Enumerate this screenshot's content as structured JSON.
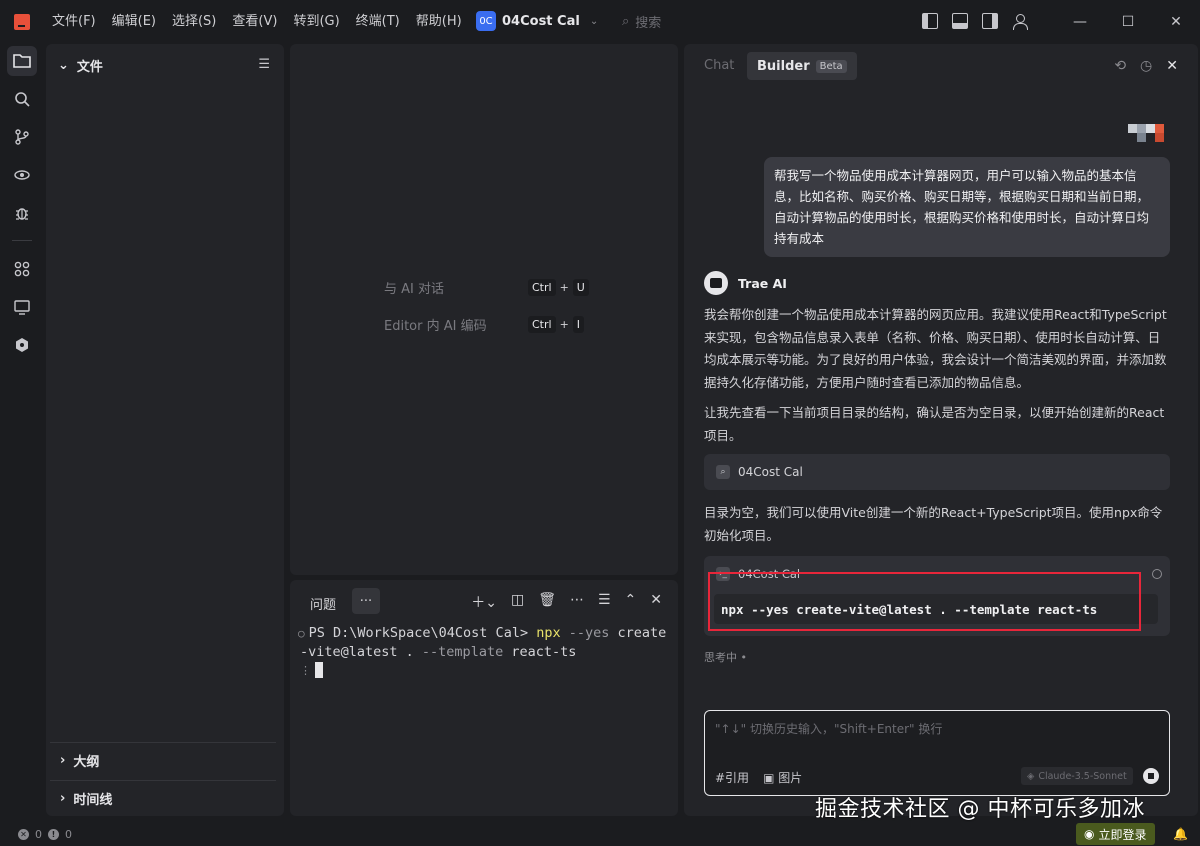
{
  "menu": [
    "文件(F)",
    "编辑(E)",
    "选择(S)",
    "查看(V)",
    "转到(G)",
    "终端(T)",
    "帮助(H)"
  ],
  "project": {
    "badge": "0C",
    "name": "04Cost Cal"
  },
  "search": {
    "placeholder": "搜索"
  },
  "sidebar": {
    "title": "文件",
    "outline": "大纲",
    "timeline": "时间线"
  },
  "editor": {
    "hints": [
      {
        "label": "与 AI 对话",
        "keys": [
          "Ctrl",
          "+",
          "U"
        ]
      },
      {
        "label": "Editor 内 AI 编码",
        "keys": [
          "Ctrl",
          "+",
          "I"
        ]
      }
    ]
  },
  "terminal": {
    "tab": "问题",
    "more": "···",
    "prompt": "PS D:\\WorkSpace\\04Cost Cal>",
    "cmd": "npx",
    "arg1": "--yes",
    "rest1": "create",
    "line2": "-vite@latest . ",
    "arg2": "--template",
    "rest2": "react-ts"
  },
  "right": {
    "tab_chat": "Chat",
    "tab_builder": "Builder",
    "beta": "Beta",
    "user_message": "帮我写一个物品使用成本计算器网页，用户可以输入物品的基本信息，比如名称、购买价格、购买日期等，根据购买日期和当前日期，自动计算物品的使用时长，根据购买价格和使用时长，自动计算日均持有成本",
    "ai_name": "Trae AI",
    "p1": "我会帮你创建一个物品使用成本计算器的网页应用。我建议使用React和TypeScript来实现，包含物品信息录入表单（名称、价格、购买日期）、使用时长自动计算、日均成本展示等功能。为了良好的用户体验，我会设计一个简洁美观的界面，并添加数据持久化存储功能，方便用户随时查看已添加的物品信息。",
    "p2": "让我先查看一下当前项目目录的结构，确认是否为空目录，以便开始创建新的React项目。",
    "file_box": "04Cost Cal",
    "p3": "目录为空，我们可以使用Vite创建一个新的React+TypeScript项目。使用npx命令初始化项目。",
    "cmd_title": "04Cost Cal",
    "cmd_code": "npx --yes create-vite@latest . --template react-ts",
    "thinking": "思考中 •",
    "input_placeholder": "\"↑↓\" 切换历史输入，\"Shift+Enter\" 换行",
    "ref_label": "#引用",
    "image_label": "图片",
    "model": "Claude-3.5-Sonnet"
  },
  "watermark": "掘金技术社区 @ 中杯可乐多加冰",
  "status": {
    "errors": "0",
    "warnings": "0",
    "login": "立即登录"
  },
  "colors": {
    "accent": "#3a6df0",
    "highlight": "#e8263a",
    "logo": "#e8503a",
    "login_bg": "#4a5a1e"
  }
}
